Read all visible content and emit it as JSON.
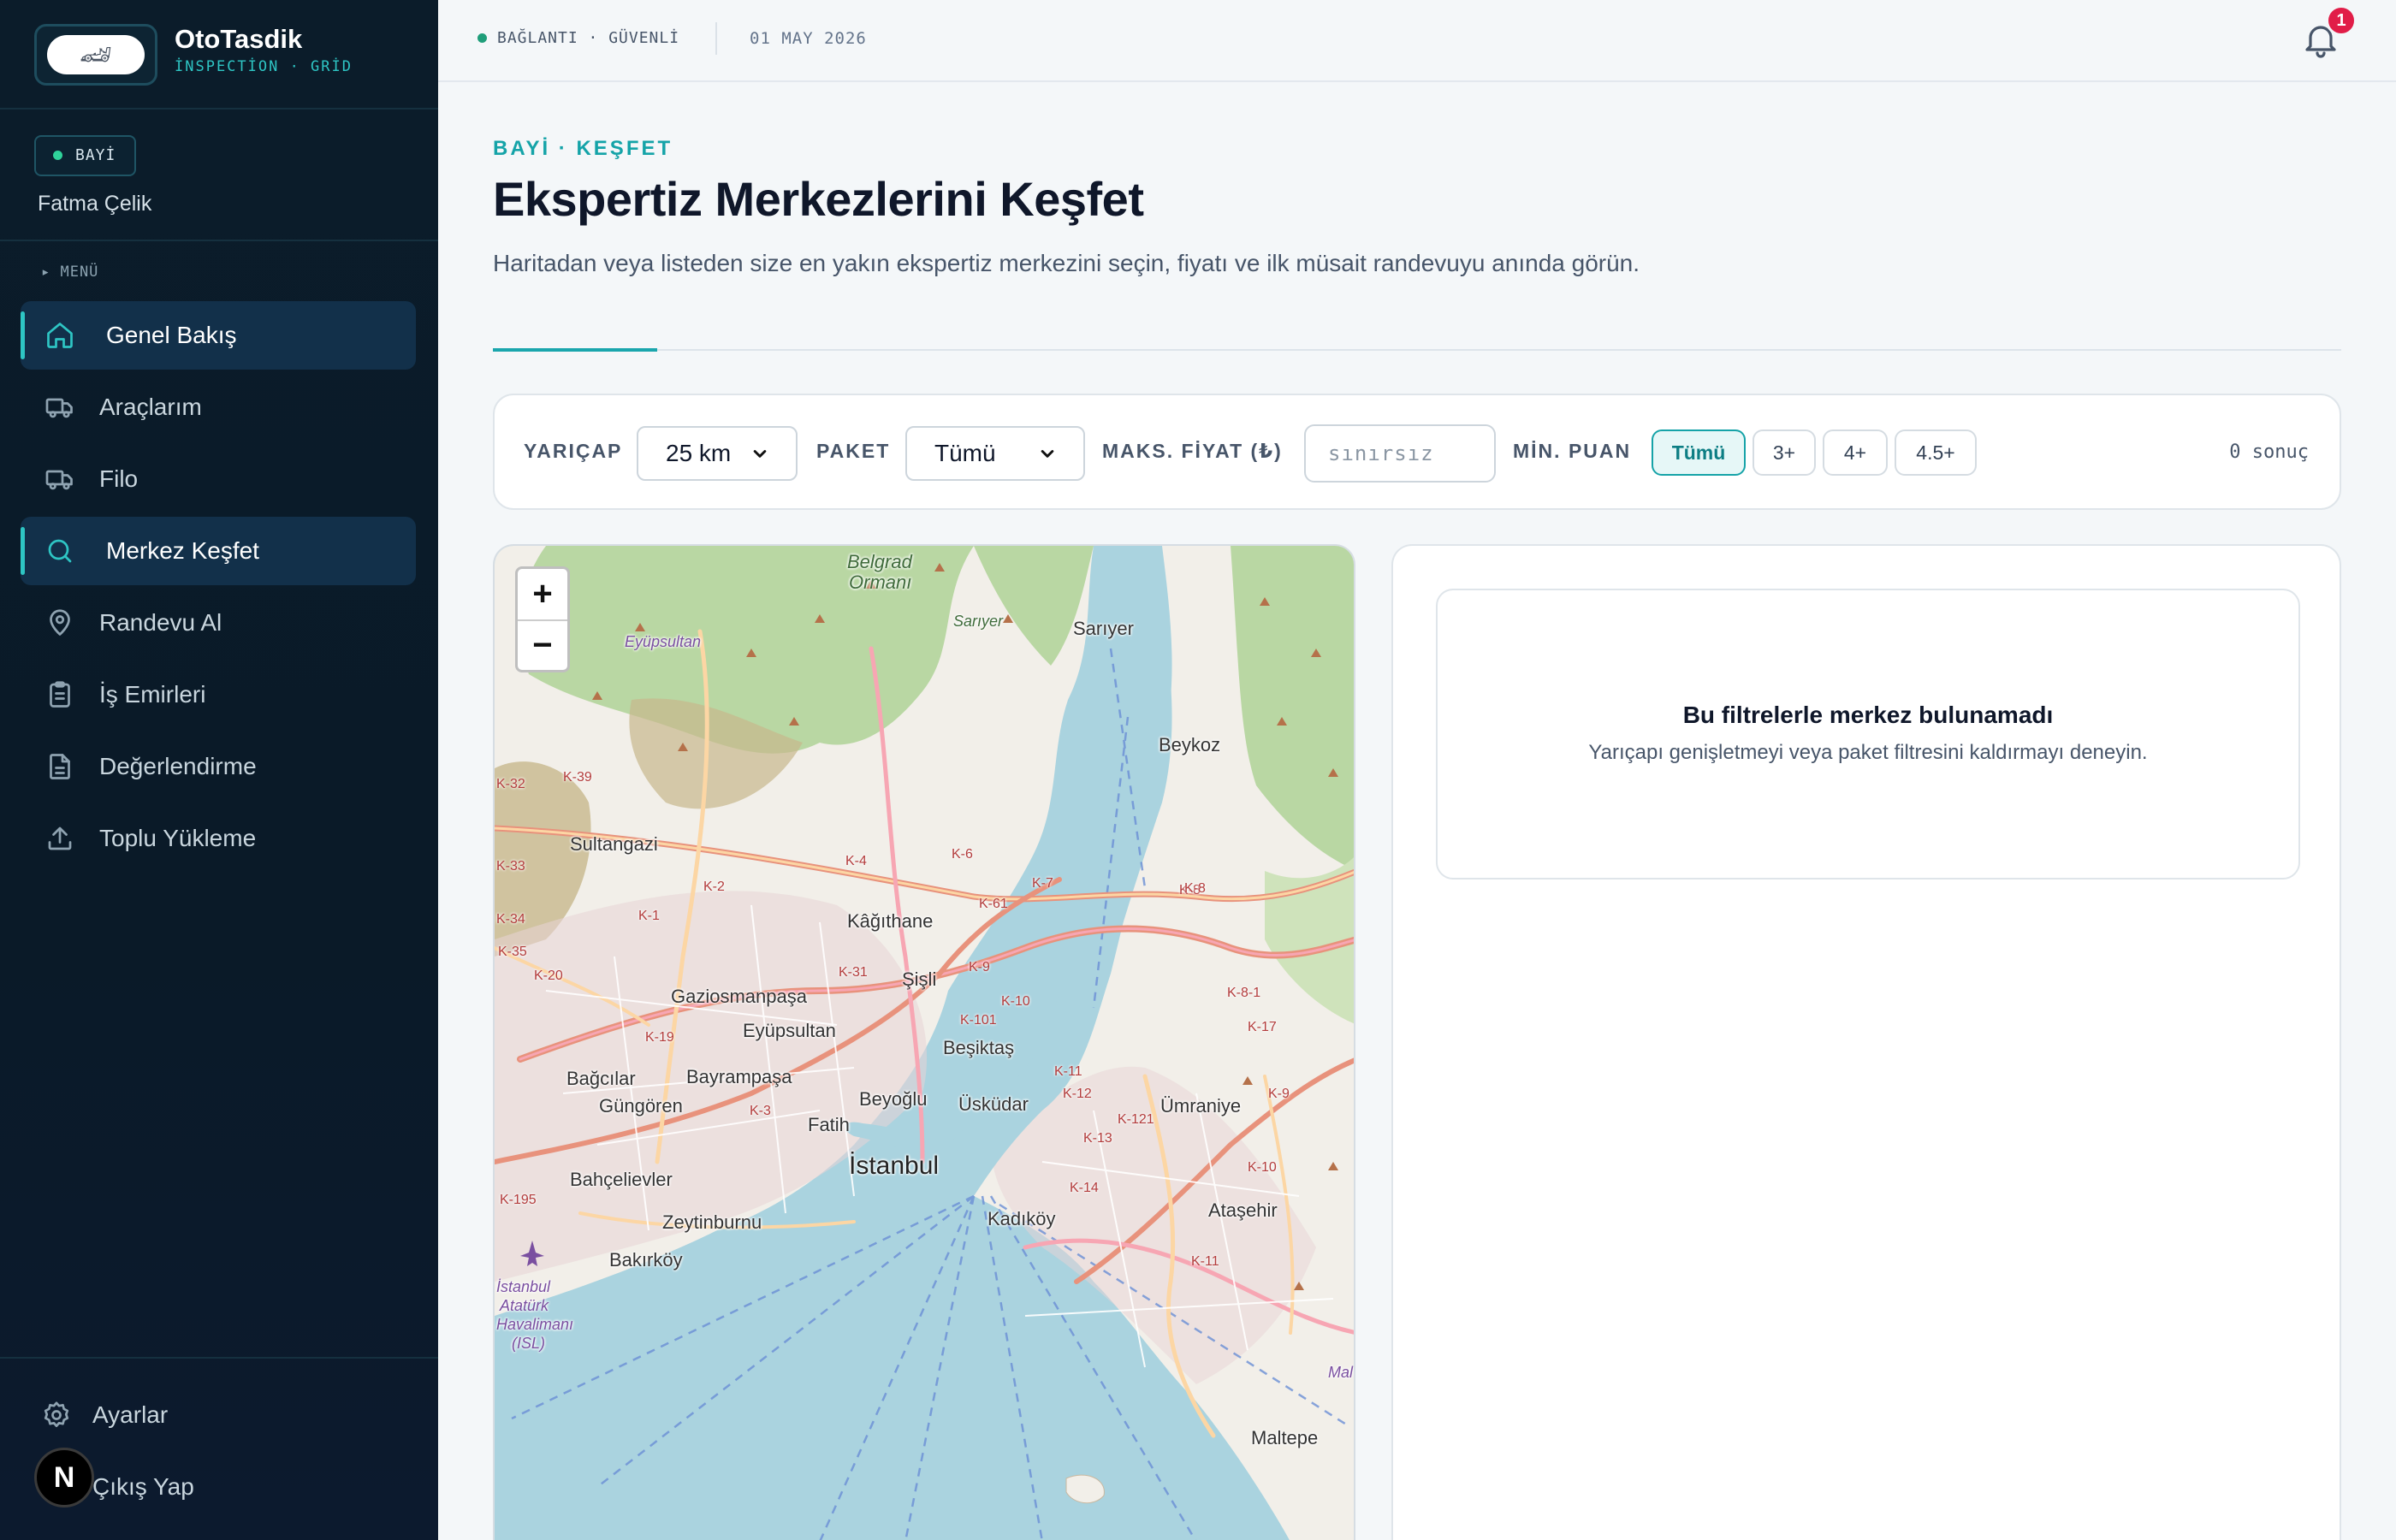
{
  "brand": {
    "name": "OtoTasdik",
    "subtitle": "İNSPECTİON · GRİD",
    "logo_glyph": "🏎"
  },
  "user": {
    "role": "BAYİ",
    "name": "Fatma Çelik"
  },
  "menu_label": "▸ MENÜ",
  "nav": [
    {
      "label": "Genel Bakış",
      "icon": "home-icon",
      "active": true
    },
    {
      "label": "Araçlarım",
      "icon": "truck-icon",
      "active": false
    },
    {
      "label": "Filo",
      "icon": "truck-icon",
      "active": false
    },
    {
      "label": "Merkez Keşfet",
      "icon": "search-icon",
      "active": true
    },
    {
      "label": "Randevu Al",
      "icon": "map-pin-icon",
      "active": false
    },
    {
      "label": "İş Emirleri",
      "icon": "clipboard-icon",
      "active": false
    },
    {
      "label": "Değerlendirme",
      "icon": "document-icon",
      "active": false
    },
    {
      "label": "Toplu Yükleme",
      "icon": "upload-icon",
      "active": false
    }
  ],
  "bottom_nav": {
    "settings": "Ayarlar",
    "logout": "Çıkış Yap",
    "avatar_letter": "N"
  },
  "topbar": {
    "connection": "BAĞLANTI · GÜVENLİ",
    "date": "01 MAY 2026",
    "notifications": "1"
  },
  "header": {
    "eyebrow": "BAYİ · KEŞFET",
    "title": "Ekspertiz Merkezlerini Keşfet",
    "description": "Haritadan veya listeden size en yakın ekspertiz merkezini seçin, fiyatı ve ilk müsait randevuyu anında görün."
  },
  "filters": {
    "radius_label": "YARIÇAP",
    "radius_value": "25 km",
    "package_label": "PAKET",
    "package_value": "Tümü",
    "max_price_label": "MAKS. FİYAT (₺)",
    "max_price_placeholder": "sınırsız",
    "min_rating_label": "MİN. PUAN",
    "rating_chips": [
      {
        "label": "Tümü",
        "active": true
      },
      {
        "label": "3+",
        "active": false
      },
      {
        "label": "4+",
        "active": false
      },
      {
        "label": "4.5+",
        "active": false
      }
    ],
    "result_count": "0 sonuç"
  },
  "map": {
    "zoom_in": "+",
    "zoom_out": "−",
    "labels": {
      "belgrad": "Belgrad",
      "ormani": "Ormanı",
      "sariyer_forest": "Sarıyer",
      "sariyer": "Sarıyer",
      "eyupsultan": "Eyüpsultan",
      "beykoz": "Beykoz",
      "sultangazi": "Sultangazi",
      "kagithane": "Kâğıthane",
      "sisli": "Şişli",
      "gaziosmanpasa": "Gaziosmanpaşa",
      "eyupsultan2": "Eyüpsultan",
      "besiktas": "Beşiktaş",
      "bagcilar": "Bağcılar",
      "bayrampasa": "Bayrampaşa",
      "gungoren": "Güngören",
      "beyoglu": "Beyoğlu",
      "uskudar": "Üsküdar",
      "umraniye": "Ümraniye",
      "fatih": "Fatih",
      "istanbul": "İstanbul",
      "bahcelievler": "Bahçelievler",
      "zeytinburnu": "Zeytinburnu",
      "kadikoy": "Kadıköy",
      "atasehir": "Ataşehir",
      "bakirkoy": "Bakırköy",
      "airport1": "İstanbul",
      "airport2": "Atatürk",
      "airport3": "Havalimanı",
      "airport4": "(ISL)",
      "maltepe": "Maltepe",
      "mal": "Mal"
    },
    "roads": [
      "K-39",
      "K-4",
      "K-6",
      "K-7",
      "K-8",
      "K-2",
      "K-1",
      "K-61",
      "K-31",
      "K-9",
      "K-10",
      "K-101",
      "K-11",
      "K-12",
      "K-121",
      "K-13",
      "K-14",
      "K-19",
      "K-20",
      "K-35",
      "K-3",
      "K-8-1",
      "K-195",
      "K-17",
      "K-11",
      "K-10",
      "K-9",
      "K-8",
      "K-32",
      "K-33",
      "K-34"
    ]
  },
  "empty_state": {
    "title": "Bu filtrelerle merkez bulunamadı",
    "description": "Yarıçapı genişletmeyi veya paket filtresini kaldırmayı deneyin."
  }
}
